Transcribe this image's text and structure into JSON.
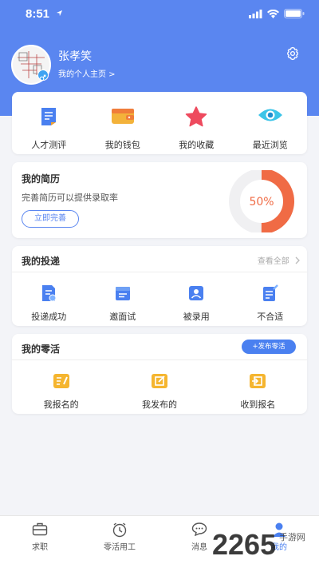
{
  "status_bar": {
    "time": "8:51"
  },
  "profile": {
    "name": "张孝笑",
    "homepage_link": "我的个人主页 >"
  },
  "quick_actions": [
    {
      "label": "人才测评",
      "icon": "document-icon"
    },
    {
      "label": "我的钱包",
      "icon": "wallet-icon"
    },
    {
      "label": "我的收藏",
      "icon": "star-icon"
    },
    {
      "label": "最近浏览",
      "icon": "eye-icon"
    }
  ],
  "resume": {
    "title": "我的简历",
    "subtitle": "完善简历可以提供录取率",
    "button": "立即完善",
    "progress_label": "50%",
    "progress": 0.5
  },
  "deliveries": {
    "title": "我的投递",
    "see_all": "查看全部",
    "items": [
      {
        "label": "投递成功",
        "icon": "sent-doc-icon"
      },
      {
        "label": "邀面试",
        "icon": "folder-icon"
      },
      {
        "label": "被录用",
        "icon": "user-card-icon"
      },
      {
        "label": "不合适",
        "icon": "edit-doc-icon"
      }
    ]
  },
  "gigs": {
    "title": "我的零活",
    "publish_button": "+发布零活",
    "items": [
      {
        "label": "我报名的",
        "icon": "signup-icon"
      },
      {
        "label": "我发布的",
        "icon": "publish-icon"
      },
      {
        "label": "收到报名",
        "icon": "inbox-icon"
      }
    ]
  },
  "tabs": [
    {
      "label": "求职",
      "icon": "briefcase-icon",
      "active": false
    },
    {
      "label": "零活用工",
      "icon": "clock-icon",
      "active": false
    },
    {
      "label": "消息",
      "icon": "chat-icon",
      "active": false
    },
    {
      "label": "我的",
      "icon": "person-icon",
      "active": true
    }
  ],
  "watermark": {
    "number": "2265",
    "suffix": "手游网"
  },
  "colors": {
    "header": "#5a86f0",
    "accent": "#4a80f0",
    "progress": "#f06b45"
  }
}
